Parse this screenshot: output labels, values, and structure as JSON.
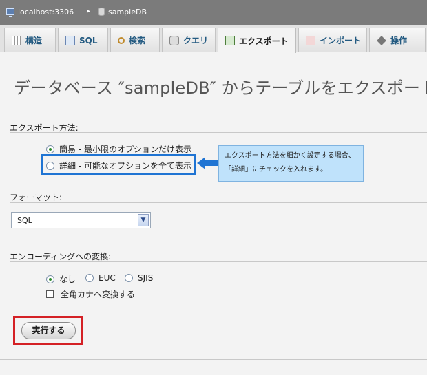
{
  "breadcrumb": {
    "server": "localhost:3306",
    "separator": "▸",
    "database": "sampleDB"
  },
  "tabs": [
    {
      "label": "構造",
      "icon": "structure-icon"
    },
    {
      "label": "SQL",
      "icon": "sql-icon"
    },
    {
      "label": "検索",
      "icon": "search-icon"
    },
    {
      "label": "クエリ",
      "icon": "query-icon"
    },
    {
      "label": "エクスポート",
      "icon": "export-icon",
      "active": true
    },
    {
      "label": "インポート",
      "icon": "import-icon"
    },
    {
      "label": "操作",
      "icon": "operations-icon"
    }
  ],
  "page_title": "データベース ″sampleDB″ からテーブルをエクスポート",
  "export_method": {
    "label": "エクスポート方法:",
    "options": [
      {
        "label": "簡易 - 最小限のオプションだけ表示",
        "selected": true
      },
      {
        "label": "詳細 - 可能なオプションを全て表示",
        "selected": false
      }
    ]
  },
  "callout": {
    "line1": "エクスポート方法を細かく設定する場合、",
    "line2": "「詳細」にチェックを入れます。"
  },
  "format": {
    "label": "フォーマット:",
    "selected": "SQL"
  },
  "encoding": {
    "label": "エンコーディングへの変換:",
    "options": [
      {
        "label": "なし",
        "selected": true
      },
      {
        "label": "EUC",
        "selected": false
      },
      {
        "label": "SJIS",
        "selected": false
      }
    ],
    "checkbox_label": "全角カナへ変換する",
    "checkbox_checked": false
  },
  "run_button": "実行する",
  "colors": {
    "highlight_blue": "#1f74d3",
    "highlight_red": "#d42025",
    "callout_bg": "#bfe2fb"
  }
}
